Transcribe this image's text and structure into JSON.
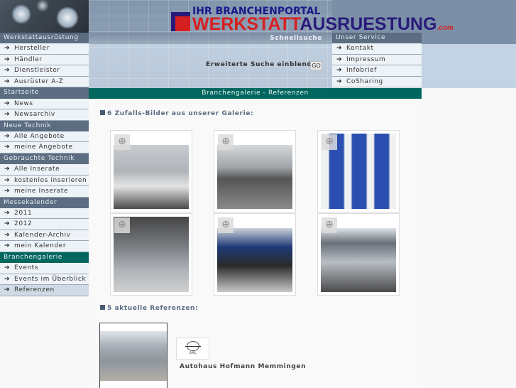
{
  "logo": {
    "line1": "IHR BRANCHENPORTAL",
    "werk": "WERKSTATT",
    "aus": "AUSRUESTUNG",
    "com": ".com"
  },
  "sidebar": [
    {
      "header": "Werkstattausrüstung",
      "items": [
        "Hersteller",
        "Händler",
        "Dienstleister",
        "Ausrüster A-Z"
      ]
    },
    {
      "header": "Startseite",
      "items": [
        "News",
        "Newsarchiv"
      ]
    },
    {
      "header": "Neue Technik",
      "items": [
        "Alle Angebote",
        "meine Angebote"
      ]
    },
    {
      "header": "Gebrauchte Technik",
      "items": [
        "Alle Inserate",
        "kostenlos inserieren",
        "meine Inserate"
      ]
    },
    {
      "header": "Messekalender",
      "items": [
        "2011",
        "2012",
        "Kalender-Archiv",
        "mein Kalender"
      ]
    },
    {
      "header": "Branchengalerie",
      "items": [
        "Events",
        "Events im Überblick",
        "Referenzen"
      ],
      "active": true,
      "selected": "Referenzen"
    }
  ],
  "search": {
    "header": "Schnellsuche",
    "extended": "Erweiterte Suche einblenden",
    "go": "GO"
  },
  "service": {
    "header": "Unser Service",
    "items": [
      "Kontakt",
      "Impressum",
      "Infobrief",
      "CoSharing"
    ]
  },
  "breadcrumb": "Branchengalerie - Referenzen",
  "gallery": {
    "heading": "6 Zufalls-Bilder aus unserer Galerie:",
    "zoom_icon": "magnifier-plus-icon"
  },
  "references": {
    "heading": "5 aktuelle Referenzen:",
    "items": [
      {
        "name": "Autohaus Hofmann Memmingen",
        "logo": "OPEL"
      }
    ]
  },
  "colors": {
    "teal": "#00675f",
    "nav_header": "#5c6d82",
    "accent_red": "#d62020",
    "accent_navy": "#2a1a7a"
  }
}
